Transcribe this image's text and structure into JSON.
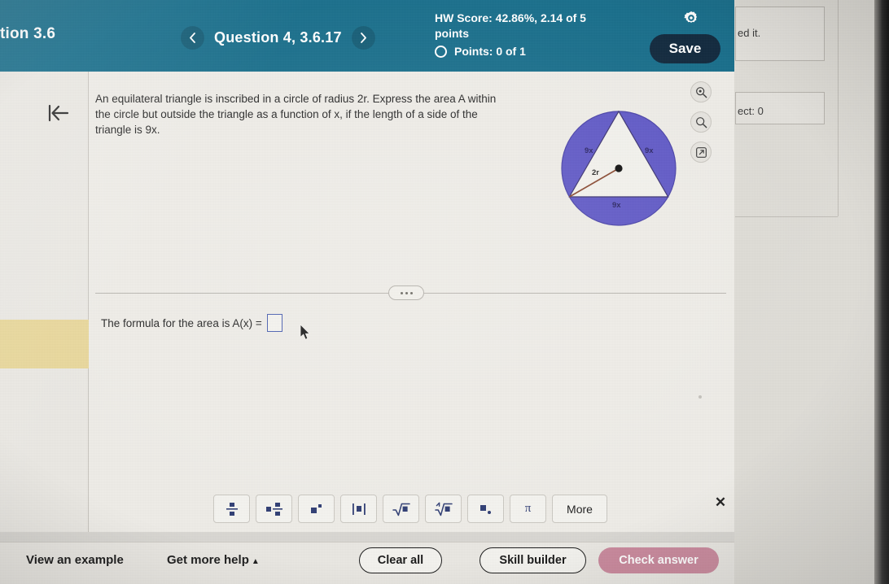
{
  "header": {
    "section_title": "tion 3.6",
    "prev_icon": "chevron-left-icon",
    "next_icon": "chevron-right-icon",
    "question_label": "Question 4, 3.6.17",
    "hw_score": "HW Score: 42.86%, 2.14 of 5 points",
    "points": "Points: 0 of 1",
    "gear_icon": "gear-icon",
    "save_label": "Save",
    "teal": "#1a6f8c",
    "save_bg": "#132b3f"
  },
  "rail": {
    "back_icon": "back-to-start-icon"
  },
  "question": {
    "text": "An equilateral triangle is inscribed in a circle of radius 2r. Express the area A within the circle but outside the triangle as a function of x, if the length of a side of the triangle is 9x."
  },
  "figure": {
    "circle_fill": "#615ac6",
    "triangle_fill": "#f2f1ec",
    "radius_line_color": "#8a4a32",
    "side_label_left": "9x",
    "side_label_right": "9x",
    "side_label_bottom": "9x",
    "radius_label": "2r",
    "center_dot": "center-point"
  },
  "figure_tools": [
    {
      "name": "zoom-in-icon",
      "glyph": "zoom-in"
    },
    {
      "name": "magnifier-icon",
      "glyph": "magnifier"
    },
    {
      "name": "open-in-new-window-icon",
      "glyph": "external-link"
    }
  ],
  "divider": {
    "ellipsis": "..."
  },
  "answer": {
    "prompt": "The formula for the area is A(x) =",
    "value": "",
    "placeholder": ""
  },
  "math_toolbar": {
    "keys": [
      {
        "name": "fraction-key",
        "label": "fraction"
      },
      {
        "name": "mixed-number-key",
        "label": "mixed-number"
      },
      {
        "name": "exponent-key",
        "label": "exponent"
      },
      {
        "name": "absolute-value-key",
        "label": "absolute-value"
      },
      {
        "name": "square-root-key",
        "label": "square-root"
      },
      {
        "name": "nth-root-key",
        "label": "nth-root"
      },
      {
        "name": "subscript-key",
        "label": "subscript"
      },
      {
        "name": "pi-key",
        "label": "π"
      }
    ],
    "more_label": "More",
    "close_icon": "close-icon",
    "close_glyph": "✕"
  },
  "bottom_bar": {
    "view_example": "View an example",
    "get_more_help": "Get more help",
    "help_caret": "▲",
    "clear_all": "Clear all",
    "skill_builder": "Skill builder",
    "check_answer": "Check answer",
    "check_bg": "#c9899c"
  },
  "background_window": {
    "fragment_one": "ed it.",
    "fragment_two": "ect: 0"
  }
}
